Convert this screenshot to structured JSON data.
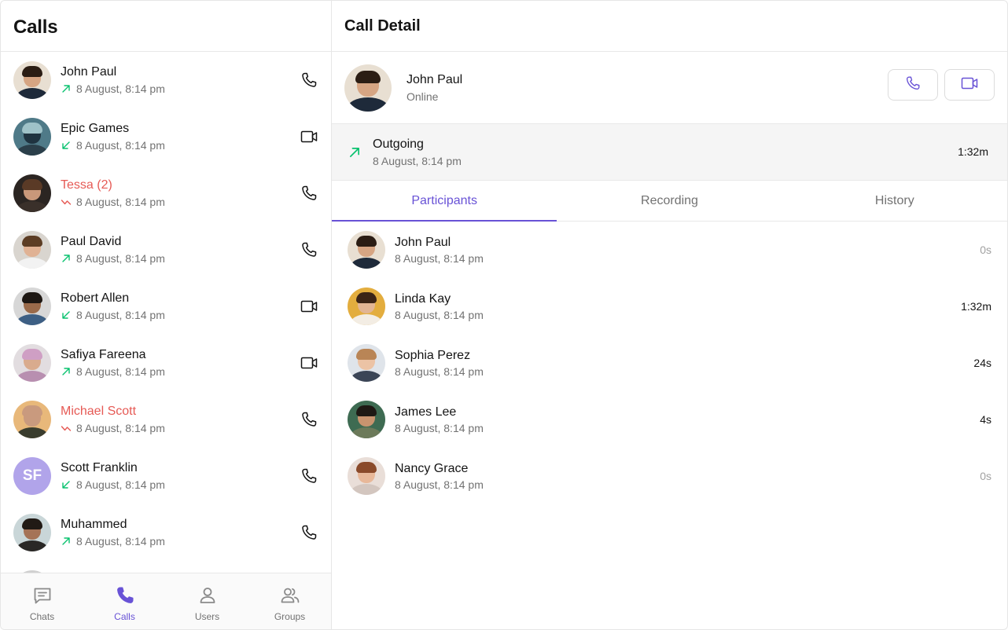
{
  "left": {
    "title": "Calls",
    "calls": [
      {
        "name": "John Paul",
        "date": "8 August, 8:14 pm",
        "direction": "outgoing",
        "type": "phone",
        "missed": false
      },
      {
        "name": "Epic Games",
        "date": "8 August, 8:14 pm",
        "direction": "incoming",
        "type": "video",
        "missed": false
      },
      {
        "name": "Tessa (2)",
        "date": "8 August, 8:14 pm",
        "direction": "missed",
        "type": "phone",
        "missed": true
      },
      {
        "name": "Paul David",
        "date": "8 August, 8:14 pm",
        "direction": "outgoing",
        "type": "phone",
        "missed": false
      },
      {
        "name": "Robert Allen",
        "date": "8 August, 8:14 pm",
        "direction": "incoming",
        "type": "video",
        "missed": false
      },
      {
        "name": "Safiya Fareena",
        "date": "8 August, 8:14 pm",
        "direction": "outgoing",
        "type": "video",
        "missed": false
      },
      {
        "name": "Michael Scott",
        "date": "8 August, 8:14 pm",
        "direction": "missed",
        "type": "phone",
        "missed": true
      },
      {
        "name": "Scott Franklin",
        "date": "8 August, 8:14 pm",
        "direction": "incoming",
        "type": "phone",
        "missed": false,
        "initials": "SF"
      },
      {
        "name": "Muhammed",
        "date": "8 August, 8:14 pm",
        "direction": "outgoing",
        "type": "phone",
        "missed": false
      }
    ]
  },
  "nav": [
    {
      "label": "Chats",
      "icon": "chat-icon",
      "active": false
    },
    {
      "label": "Calls",
      "icon": "phone-icon",
      "active": true
    },
    {
      "label": "Users",
      "icon": "user-icon",
      "active": false
    },
    {
      "label": "Groups",
      "icon": "group-icon",
      "active": false
    }
  ],
  "detail": {
    "title": "Call Detail",
    "profile": {
      "name": "John Paul",
      "status": "Online"
    },
    "summary": {
      "title": "Outgoing",
      "date": "8 August, 8:14 pm",
      "duration": "1:32m"
    },
    "tabs": [
      "Participants",
      "Recording",
      "History"
    ],
    "active_tab": 0,
    "participants": [
      {
        "name": "John Paul",
        "date": "8 August, 8:14 pm",
        "duration": "0s"
      },
      {
        "name": "Linda Kay",
        "date": "8 August, 8:14 pm",
        "duration": "1:32m"
      },
      {
        "name": "Sophia Perez",
        "date": "8 August, 8:14 pm",
        "duration": "24s"
      },
      {
        "name": "James Lee",
        "date": "8 August, 8:14 pm",
        "duration": "4s"
      },
      {
        "name": "Nancy Grace",
        "date": "8 August, 8:14 pm",
        "duration": "0s"
      }
    ]
  },
  "colors": {
    "accent": "#6852d6",
    "missed": "#e65a55",
    "success": "#09c26f",
    "muted": "#727272"
  }
}
